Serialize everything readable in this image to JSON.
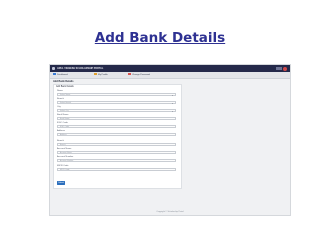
{
  "slide": {
    "title": "Add Bank Details"
  },
  "app": {
    "brand": "ARUL VIGNESH SCHOLARSHIP PORTAL",
    "nav": [
      "Dashboard",
      "My Profile",
      "Change Password"
    ],
    "breadcrumb": "Add Bank Details",
    "form": {
      "title": "Add Bank Details",
      "fields": [
        {
          "label": "Name",
          "placeholder": "Select Name",
          "type": "select"
        },
        {
          "label": "Branch",
          "placeholder": "Select Branch",
          "type": "select"
        },
        {
          "label": "City",
          "placeholder": "Select City",
          "type": "select"
        },
        {
          "label": "Bank Name",
          "placeholder": "Bank Name",
          "type": "text"
        },
        {
          "label": "IFSC Code",
          "placeholder": "IFSC Code",
          "type": "text"
        },
        {
          "label": "Address",
          "placeholder": "Address",
          "type": "text"
        },
        {
          "label": "Branch",
          "placeholder": "Branch",
          "type": "text"
        },
        {
          "label": "Account Name",
          "placeholder": "Account Name",
          "type": "text"
        },
        {
          "label": "Account Number",
          "placeholder": "Account Number",
          "type": "text"
        },
        {
          "label": "MICR Code",
          "placeholder": "MICR Code",
          "type": "text"
        }
      ],
      "submit_label": "Submit"
    },
    "footer": "Copyright © Scholarship Portal"
  },
  "colors": {
    "title": "#2e3192",
    "topbar": "#24294a",
    "primary": "#2c6fbd"
  }
}
